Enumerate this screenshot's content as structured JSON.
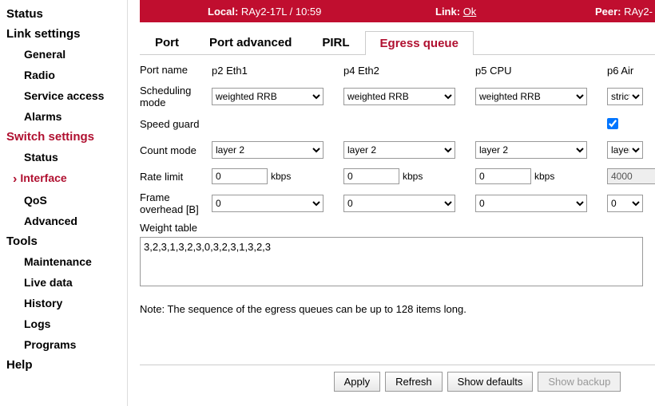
{
  "sidebar": {
    "sections": [
      {
        "label": "Status",
        "items": []
      },
      {
        "label": "Link settings",
        "items": [
          "General",
          "Radio",
          "Service access",
          "Alarms"
        ]
      },
      {
        "label": "Switch settings",
        "active": true,
        "items": [
          "Status",
          "Interface",
          "QoS",
          "Advanced"
        ],
        "activeItem": "Interface"
      },
      {
        "label": "Tools",
        "items": [
          "Maintenance",
          "Live data",
          "History",
          "Logs",
          "Programs"
        ]
      },
      {
        "label": "Help",
        "items": []
      }
    ]
  },
  "topbar": {
    "local_label": "Local:",
    "local_value": "RAy2-17L / 10:59",
    "link_label": "Link:",
    "link_value": "Ok",
    "peer_label": "Peer:",
    "peer_value": "RAy2-"
  },
  "tabs": [
    "Port",
    "Port advanced",
    "PIRL",
    "Egress queue"
  ],
  "activeTab": "Egress queue",
  "labels": {
    "port_name": "Port name",
    "scheduling_mode": "Scheduling mode",
    "speed_guard": "Speed guard",
    "count_mode": "Count mode",
    "rate_limit": "Rate limit",
    "frame_overhead": "Frame overhead [B]",
    "weight_table": "Weight table",
    "note": "Note: The sequence of the egress queues can be up to 128 items long."
  },
  "columns": [
    {
      "name": "p2 Eth1",
      "sched": "weighted RRB",
      "speed": false,
      "count": "layer 2",
      "rate": "0",
      "unit": "kbps",
      "over": "0"
    },
    {
      "name": "p4 Eth2",
      "sched": "weighted RRB",
      "speed": false,
      "count": "layer 2",
      "rate": "0",
      "unit": "kbps",
      "over": "0"
    },
    {
      "name": "p5 CPU",
      "sched": "weighted RRB",
      "speed": false,
      "count": "layer 2",
      "rate": "0",
      "unit": "kbps",
      "over": "0"
    },
    {
      "name": "p6 Air",
      "sched": "strict",
      "speed": true,
      "count": "layer",
      "rate": "4000",
      "unit": "",
      "over": "0",
      "disabled": true
    }
  ],
  "weight_value": "3,2,3,1,3,2,3,0,3,2,3,1,3,2,3",
  "buttons": {
    "apply": "Apply",
    "refresh": "Refresh",
    "show_defaults": "Show defaults",
    "show_backup": "Show backup"
  }
}
